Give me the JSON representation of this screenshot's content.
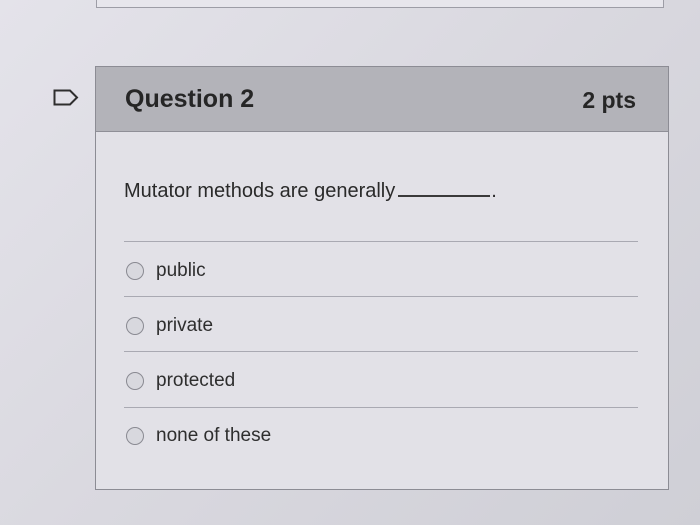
{
  "question": {
    "title": "Question 2",
    "points": "2 pts",
    "prompt": "Mutator methods are generally",
    "prompt_end": "."
  },
  "answers": [
    {
      "label": "public"
    },
    {
      "label": "private"
    },
    {
      "label": "protected"
    },
    {
      "label": "none of these"
    }
  ],
  "colors": {
    "header_bg": "#b3b3b9",
    "body_bg": "#e2e1e7",
    "border": "#8c8c94"
  },
  "icons": {
    "flag": "flag-outline-icon"
  }
}
